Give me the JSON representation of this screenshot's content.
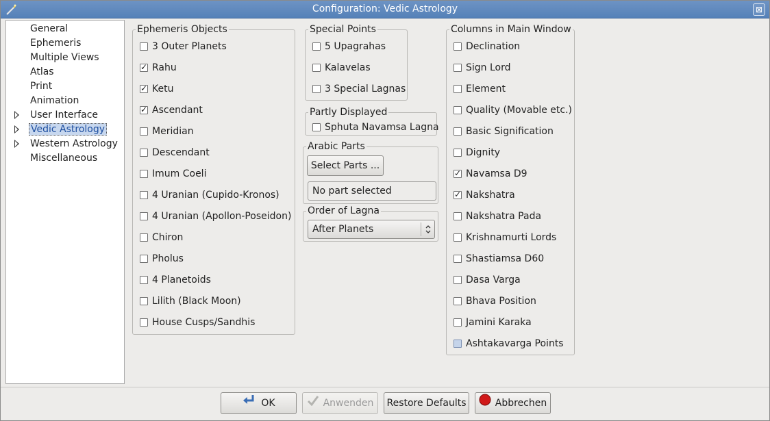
{
  "window": {
    "title": "Configuration: Vedic Astrology",
    "close_glyph": "⊠"
  },
  "sidebar": {
    "items": [
      {
        "label": "General",
        "expandable": false,
        "selected": false
      },
      {
        "label": "Ephemeris",
        "expandable": false,
        "selected": false
      },
      {
        "label": "Multiple Views",
        "expandable": false,
        "selected": false
      },
      {
        "label": "Atlas",
        "expandable": false,
        "selected": false
      },
      {
        "label": "Print",
        "expandable": false,
        "selected": false
      },
      {
        "label": "Animation",
        "expandable": false,
        "selected": false
      },
      {
        "label": "User Interface",
        "expandable": true,
        "selected": false
      },
      {
        "label": "Vedic Astrology",
        "expandable": true,
        "selected": true
      },
      {
        "label": "Western Astrology",
        "expandable": true,
        "selected": false
      },
      {
        "label": "Miscellaneous",
        "expandable": false,
        "selected": false
      }
    ]
  },
  "ephemeris_objects": {
    "title": "Ephemeris Objects",
    "items": [
      {
        "label": "3 Outer Planets",
        "state": "unchecked"
      },
      {
        "label": "Rahu",
        "state": "checked"
      },
      {
        "label": "Ketu",
        "state": "checked"
      },
      {
        "label": "Ascendant",
        "state": "checked"
      },
      {
        "label": "Meridian",
        "state": "unchecked"
      },
      {
        "label": "Descendant",
        "state": "unchecked"
      },
      {
        "label": "Imum Coeli",
        "state": "unchecked"
      },
      {
        "label": "4 Uranian (Cupido-Kronos)",
        "state": "unchecked"
      },
      {
        "label": "4 Uranian (Apollon-Poseidon)",
        "state": "unchecked"
      },
      {
        "label": "Chiron",
        "state": "unchecked"
      },
      {
        "label": "Pholus",
        "state": "unchecked"
      },
      {
        "label": "4 Planetoids",
        "state": "unchecked"
      },
      {
        "label": "Lilith (Black Moon)",
        "state": "unchecked"
      },
      {
        "label": "House Cusps/Sandhis",
        "state": "unchecked"
      }
    ]
  },
  "special_points": {
    "title": "Special Points",
    "items": [
      {
        "label": "5 Upagrahas",
        "state": "unchecked"
      },
      {
        "label": "Kalavelas",
        "state": "unchecked"
      },
      {
        "label": "3 Special Lagnas",
        "state": "unchecked"
      }
    ]
  },
  "partly_displayed": {
    "title": "Partly Displayed",
    "items": [
      {
        "label": "Sphuta Navamsa Lagna",
        "state": "unchecked"
      }
    ]
  },
  "arabic_parts": {
    "title": "Arabic Parts",
    "select_button": "Select Parts ...",
    "selection_text": "No part selected"
  },
  "order_of_lagna": {
    "title": "Order of Lagna",
    "selected": "After Planets"
  },
  "columns": {
    "title": "Columns in Main Window",
    "items": [
      {
        "label": "Declination",
        "state": "unchecked"
      },
      {
        "label": "Sign Lord",
        "state": "unchecked"
      },
      {
        "label": "Element",
        "state": "unchecked"
      },
      {
        "label": "Quality (Movable etc.)",
        "state": "unchecked"
      },
      {
        "label": "Basic Signification",
        "state": "unchecked"
      },
      {
        "label": "Dignity",
        "state": "unchecked"
      },
      {
        "label": "Navamsa D9",
        "state": "checked"
      },
      {
        "label": "Nakshatra",
        "state": "checked"
      },
      {
        "label": "Nakshatra Pada",
        "state": "unchecked"
      },
      {
        "label": "Krishnamurti Lords",
        "state": "unchecked"
      },
      {
        "label": "Shastiamsa D60",
        "state": "unchecked"
      },
      {
        "label": "Dasa Varga",
        "state": "unchecked"
      },
      {
        "label": "Bhava Position",
        "state": "unchecked"
      },
      {
        "label": "Jamini Karaka",
        "state": "unchecked"
      },
      {
        "label": "Ashtakavarga Points",
        "state": "partial"
      }
    ]
  },
  "buttons": {
    "ok": "OK",
    "apply": "Anwenden",
    "restore": "Restore Defaults",
    "cancel": "Abbrechen"
  },
  "colors": {
    "titlebar": "#5a86bd",
    "selection": "#c7d7ee",
    "cancel_icon": "#d01818",
    "ok_icon": "#3a6db5"
  }
}
